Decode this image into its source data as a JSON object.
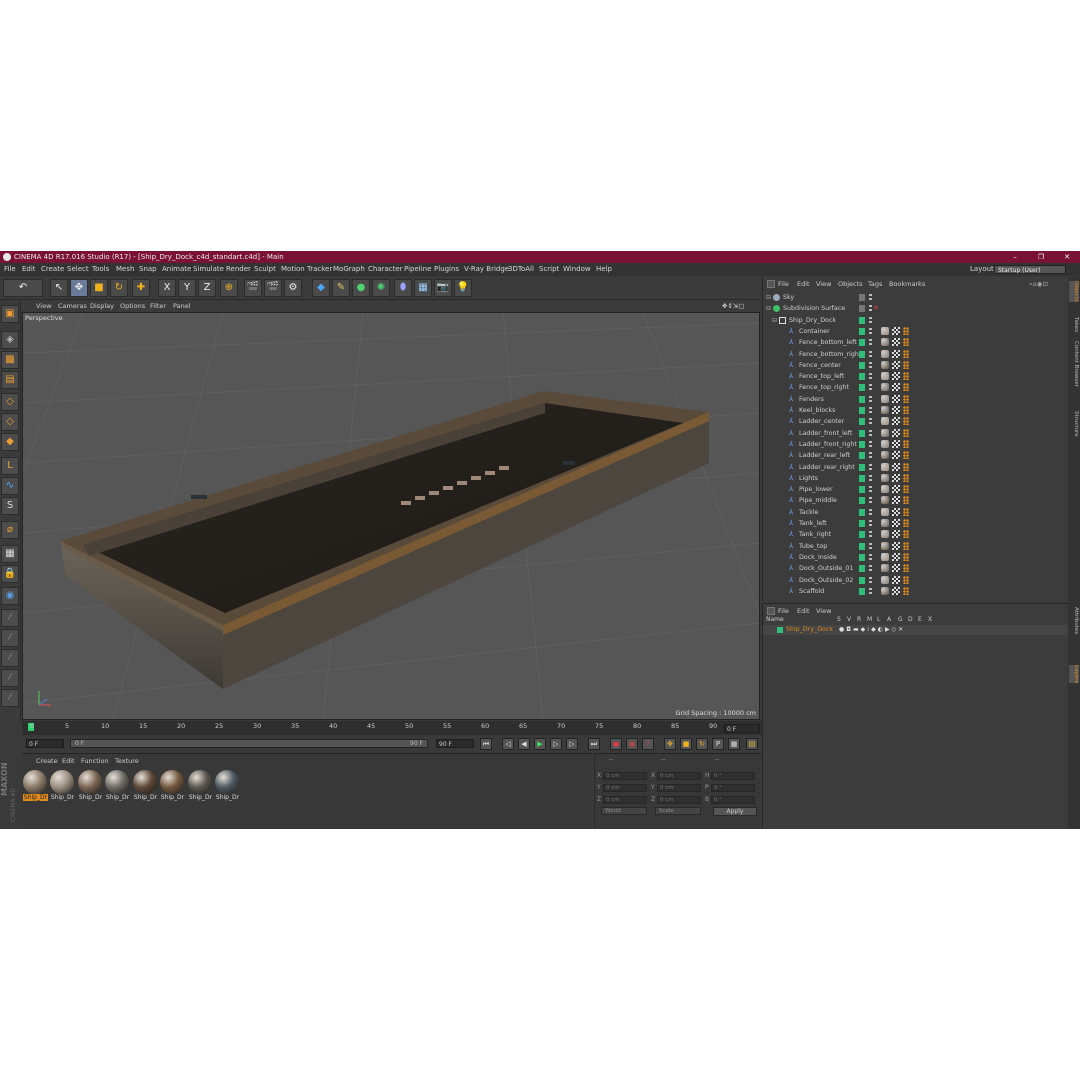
{
  "window": {
    "title": "CINEMA 4D R17.016 Studio (R17) - [Ship_Dry_Dock_c4d_standart.c4d] - Main",
    "minimize": "–",
    "maximize": "❐",
    "close": "✕"
  },
  "menubar": {
    "items": [
      "File",
      "Edit",
      "Create",
      "Select",
      "Tools",
      "Mesh",
      "Snap",
      "Animate",
      "Simulate",
      "Render",
      "Sculpt",
      "Motion Tracker",
      "MoGraph",
      "Character",
      "Pipeline",
      "Plugins",
      "V-Ray Bridge",
      "3DToAll",
      "Script",
      "Window",
      "Help"
    ],
    "layout_label": "Layout:",
    "layout_value": "Startup (User)"
  },
  "viewport": {
    "menu": [
      "View",
      "Cameras",
      "Display",
      "Options",
      "Filter",
      "Panel"
    ],
    "label": "Perspective",
    "grid_spacing": "Grid Spacing : 10000 cm"
  },
  "timeline": {
    "ticks": [
      "0",
      "5",
      "10",
      "15",
      "20",
      "25",
      "30",
      "35",
      "40",
      "45",
      "50",
      "55",
      "60",
      "65",
      "70",
      "75",
      "80",
      "85",
      "90"
    ],
    "end_field": "0 F",
    "current_frame": "0 F",
    "start_field": "0 F",
    "range_end": "90 F",
    "max_frame": "90 F"
  },
  "materials": {
    "menu": [
      "Create",
      "Edit",
      "Function",
      "Texture"
    ],
    "items": [
      {
        "label": "Ship_Dr",
        "color": "#8a7a66"
      },
      {
        "label": "Ship_Dr",
        "color": "#9b8f80"
      },
      {
        "label": "Ship_Dr",
        "color": "#7a6552"
      },
      {
        "label": "Ship_Dr",
        "color": "#6e6a64"
      },
      {
        "label": "Ship_Dr",
        "color": "#5e4a38"
      },
      {
        "label": "Ship_Dr",
        "color": "#73583f"
      },
      {
        "label": "Ship_Dr",
        "color": "#5c5750"
      },
      {
        "label": "Ship_Dr",
        "color": "#4e5a62"
      }
    ],
    "brand_top": "MAXON",
    "brand_bottom": "CINEMA 4D"
  },
  "coordinates": {
    "header": [
      "--",
      "--",
      "--"
    ],
    "rows": [
      {
        "axis": "X",
        "pos": "0 cm",
        "axis2": "X",
        "size": "0 cm",
        "axis3": "H",
        "rot": "0 °"
      },
      {
        "axis": "Y",
        "pos": "0 cm",
        "axis2": "Y",
        "size": "0 cm",
        "axis3": "P",
        "rot": "0 °"
      },
      {
        "axis": "Z",
        "pos": "0 cm",
        "axis2": "Z",
        "size": "0 cm",
        "axis3": "B",
        "rot": "0 °"
      }
    ],
    "mode": "World",
    "scale_mode": "Scale",
    "apply": "Apply"
  },
  "object_manager": {
    "menu": [
      "File",
      "Edit",
      "View",
      "Objects",
      "Tags",
      "Bookmarks"
    ],
    "objects": [
      {
        "name": "Sky",
        "level": 0
      },
      {
        "name": "Subdivision Surface",
        "level": 0
      },
      {
        "name": "Ship_Dry_Dock",
        "level": 1
      },
      {
        "name": "Container",
        "level": 2
      },
      {
        "name": "Fence_bottom_left",
        "level": 2
      },
      {
        "name": "Fence_bottom_right",
        "level": 2
      },
      {
        "name": "Fence_center",
        "level": 2
      },
      {
        "name": "Fence_top_left",
        "level": 2
      },
      {
        "name": "Fence_top_right",
        "level": 2
      },
      {
        "name": "Fenders",
        "level": 2
      },
      {
        "name": "Keel_blocks",
        "level": 2
      },
      {
        "name": "Ladder_center",
        "level": 2
      },
      {
        "name": "Ladder_front_left",
        "level": 2
      },
      {
        "name": "Ladder_front_right",
        "level": 2
      },
      {
        "name": "Ladder_rear_left",
        "level": 2
      },
      {
        "name": "Ladder_rear_right",
        "level": 2
      },
      {
        "name": "Lights",
        "level": 2
      },
      {
        "name": "Pipe_lower",
        "level": 2
      },
      {
        "name": "Pipe_middle",
        "level": 2
      },
      {
        "name": "Tackle",
        "level": 2
      },
      {
        "name": "Tank_left",
        "level": 2
      },
      {
        "name": "Tank_right",
        "level": 2
      },
      {
        "name": "Tube_top",
        "level": 2
      },
      {
        "name": "Dock_Inside",
        "level": 2
      },
      {
        "name": "Dock_Outside_01",
        "level": 2
      },
      {
        "name": "Dock_Outside_02",
        "level": 2
      },
      {
        "name": "Scaffold",
        "level": 2
      }
    ]
  },
  "layer_manager": {
    "menu": [
      "File",
      "Edit",
      "View"
    ],
    "columns": [
      "Name",
      "S",
      "V",
      "R",
      "M",
      "L",
      "A",
      "G",
      "D",
      "E",
      "X"
    ],
    "layer_name": "Ship_Dry_Dock"
  },
  "side_tabs": [
    "Objects",
    "Takes",
    "Content Browser",
    "Structure",
    "Attributes",
    "Layers"
  ],
  "colors": {
    "title_bar": "#7a1236",
    "layer_green": "#2fbf7a",
    "accent_orange": "#e08a1e"
  }
}
